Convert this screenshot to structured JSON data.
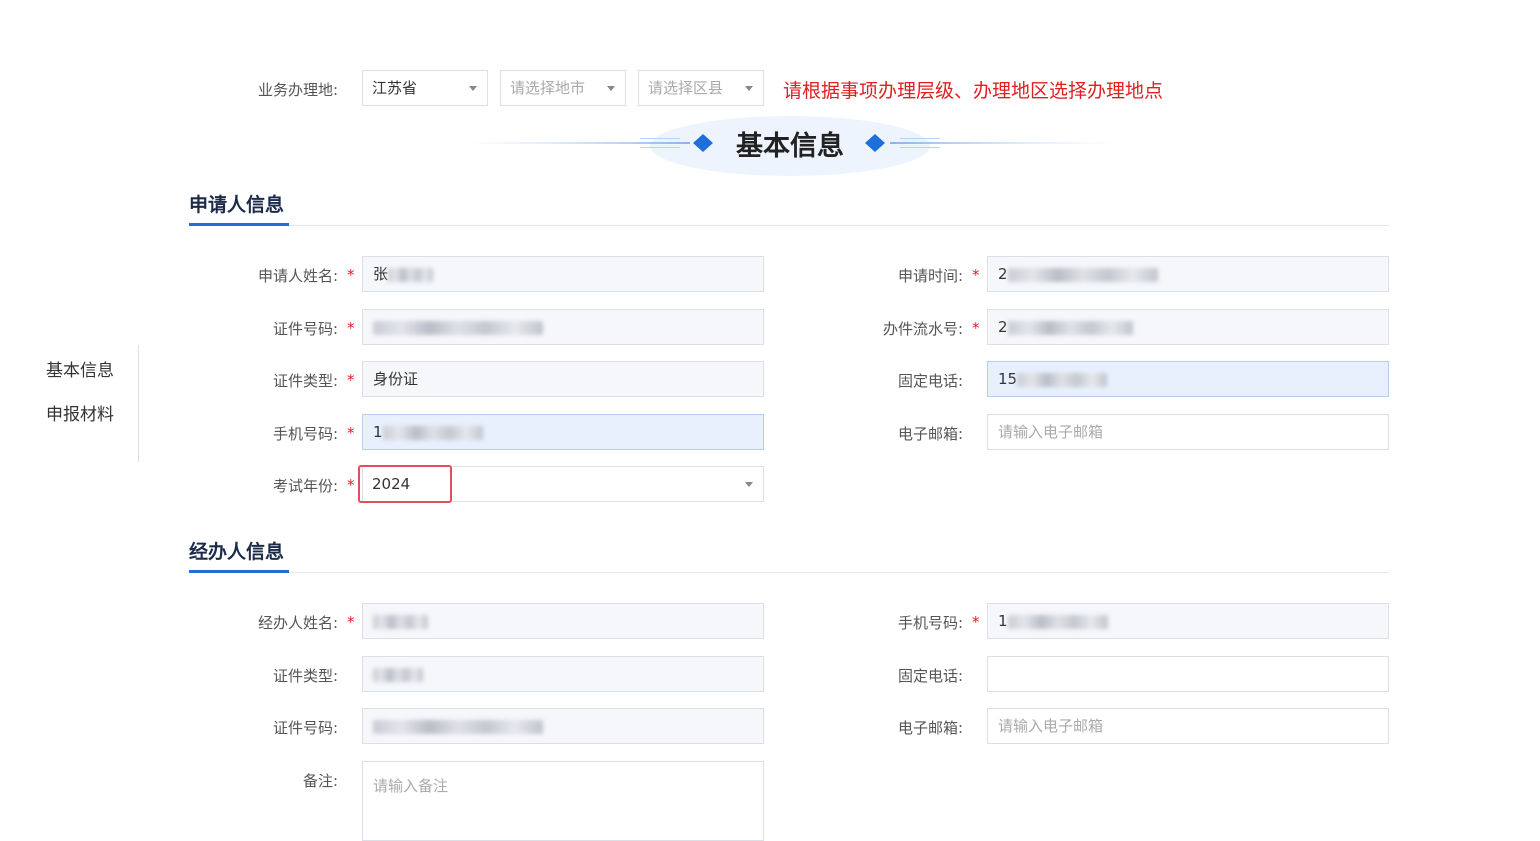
{
  "location": {
    "label": "业务办理地:",
    "province": "江苏省",
    "city_placeholder": "请选择地市",
    "county_placeholder": "请选择区县",
    "hint": "请根据事项办理层级、办理地区选择办理地点"
  },
  "banner": {
    "title": "基本信息"
  },
  "sidebar": {
    "items": [
      "基本信息",
      "申报材料"
    ]
  },
  "applicant": {
    "title": "申请人信息",
    "name_label": "申请人姓名:",
    "name_value": "张",
    "apply_time_label": "申请时间:",
    "apply_time_value": "2",
    "id_number_label": "证件号码:",
    "serial_label": "办件流水号:",
    "serial_value": "2",
    "id_type_label": "证件类型:",
    "id_type_value": "身份证",
    "phone_fixed_label": "固定电话:",
    "phone_fixed_value": "15",
    "mobile_label": "手机号码:",
    "mobile_value": "1",
    "email_label": "电子邮箱:",
    "email_placeholder": "请输入电子邮箱",
    "exam_year_label": "考试年份:",
    "exam_year_value": "2024"
  },
  "agent": {
    "title": "经办人信息",
    "name_label": "经办人姓名:",
    "mobile_label": "手机号码:",
    "mobile_value": "1",
    "id_type_label": "证件类型:",
    "phone_fixed_label": "固定电话:",
    "id_number_label": "证件号码:",
    "email_label": "电子邮箱:",
    "email_placeholder": "请输入电子邮箱",
    "remark_label": "备注:",
    "remark_placeholder": "请输入备注"
  },
  "colors": {
    "accent": "#1e6fd9",
    "required": "#e02020",
    "hint": "#e02020",
    "highlight_box": "#e0505a"
  }
}
